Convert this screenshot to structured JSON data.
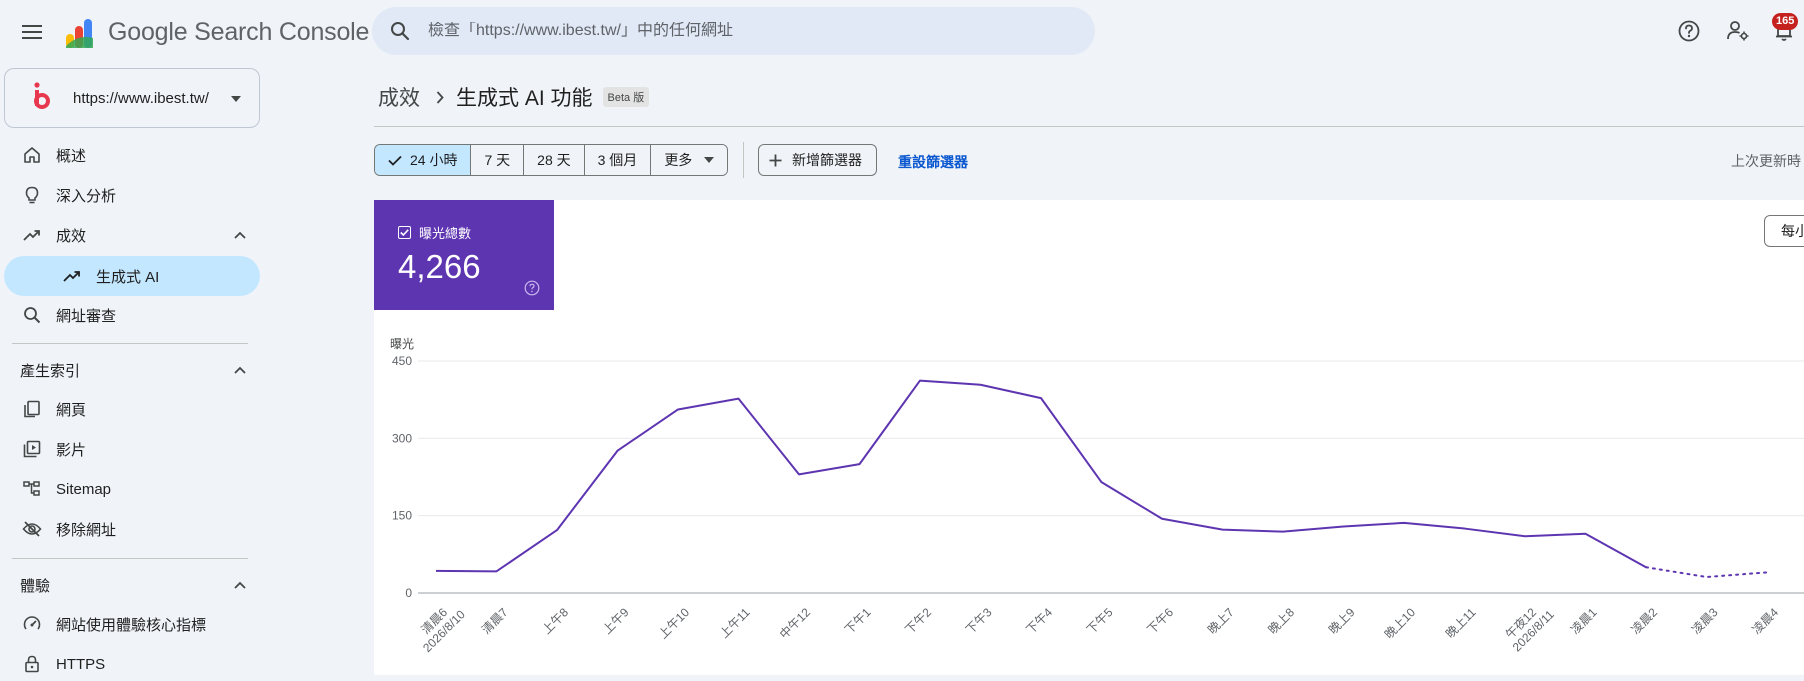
{
  "app": {
    "title": "Google Search Console"
  },
  "search": {
    "placeholder": "檢查「https://www.ibest.tw/」中的任何網址"
  },
  "header": {
    "notification_count": "165"
  },
  "property": {
    "url": "https://www.ibest.tw/"
  },
  "sidebar": {
    "items": [
      {
        "label": "概述",
        "icon": "home-icon"
      },
      {
        "label": "深入分析",
        "icon": "lightbulb-icon"
      },
      {
        "label": "成效",
        "icon": "trending-up-icon"
      },
      {
        "label": "生成式 AI",
        "icon": "trending-up-icon"
      },
      {
        "label": "網址審查",
        "icon": "search-icon"
      }
    ],
    "index_section": {
      "title": "產生索引",
      "items": [
        {
          "label": "網頁",
          "icon": "pages-icon"
        },
        {
          "label": "影片",
          "icon": "video-icon"
        },
        {
          "label": "Sitemap",
          "icon": "sitemap-icon"
        },
        {
          "label": "移除網址",
          "icon": "eye-off-icon"
        }
      ]
    },
    "experience_section": {
      "title": "體驗",
      "items": [
        {
          "label": "網站使用體驗核心指標",
          "icon": "gauge-icon"
        },
        {
          "label": "HTTPS",
          "icon": "lock-icon"
        }
      ]
    }
  },
  "breadcrumb": {
    "parent": "成效",
    "title": "生成式 AI 功能",
    "badge": "Beta 版"
  },
  "filters": {
    "ranges": [
      "24 小時",
      "7 天",
      "28 天",
      "3 個月"
    ],
    "selected": "24 小時",
    "more": "更多",
    "add_filter": "新增篩選器",
    "reset": "重設篩選器",
    "last_updated": "上次更新時"
  },
  "metric": {
    "label": "曝光總數",
    "value": "4,266"
  },
  "granularity": {
    "label": "每小"
  },
  "colors": {
    "accent": "#5e35b1",
    "selected": "#c2e7ff",
    "link": "#0b57d0"
  },
  "chart_data": {
    "type": "line",
    "ylabel": "曝光",
    "ylim": [
      0,
      450
    ],
    "yticks": [
      0,
      150,
      300,
      450
    ],
    "grid": true,
    "categories": [
      "清晨6\n2026/8/10",
      "清晨7",
      "上午8",
      "上午9",
      "上午10",
      "上午11",
      "中午12",
      "下午1",
      "下午2",
      "下午3",
      "下午4",
      "下午5",
      "下午6",
      "晚上7",
      "晚上8",
      "晚上9",
      "晚上10",
      "晚上11",
      "午夜12\n2026/8/11",
      "凌晨1",
      "凌晨2",
      "凌晨3",
      "凌晨4"
    ],
    "series": [
      {
        "values": [
          43,
          42,
          122,
          276,
          356,
          377,
          230,
          250,
          412,
          404,
          378,
          215,
          144,
          123,
          119,
          129,
          136,
          125,
          110,
          115,
          50
        ],
        "style": "solid"
      },
      {
        "start_index": 20,
        "values": [
          50,
          31,
          40
        ],
        "style": "dotted"
      }
    ]
  }
}
